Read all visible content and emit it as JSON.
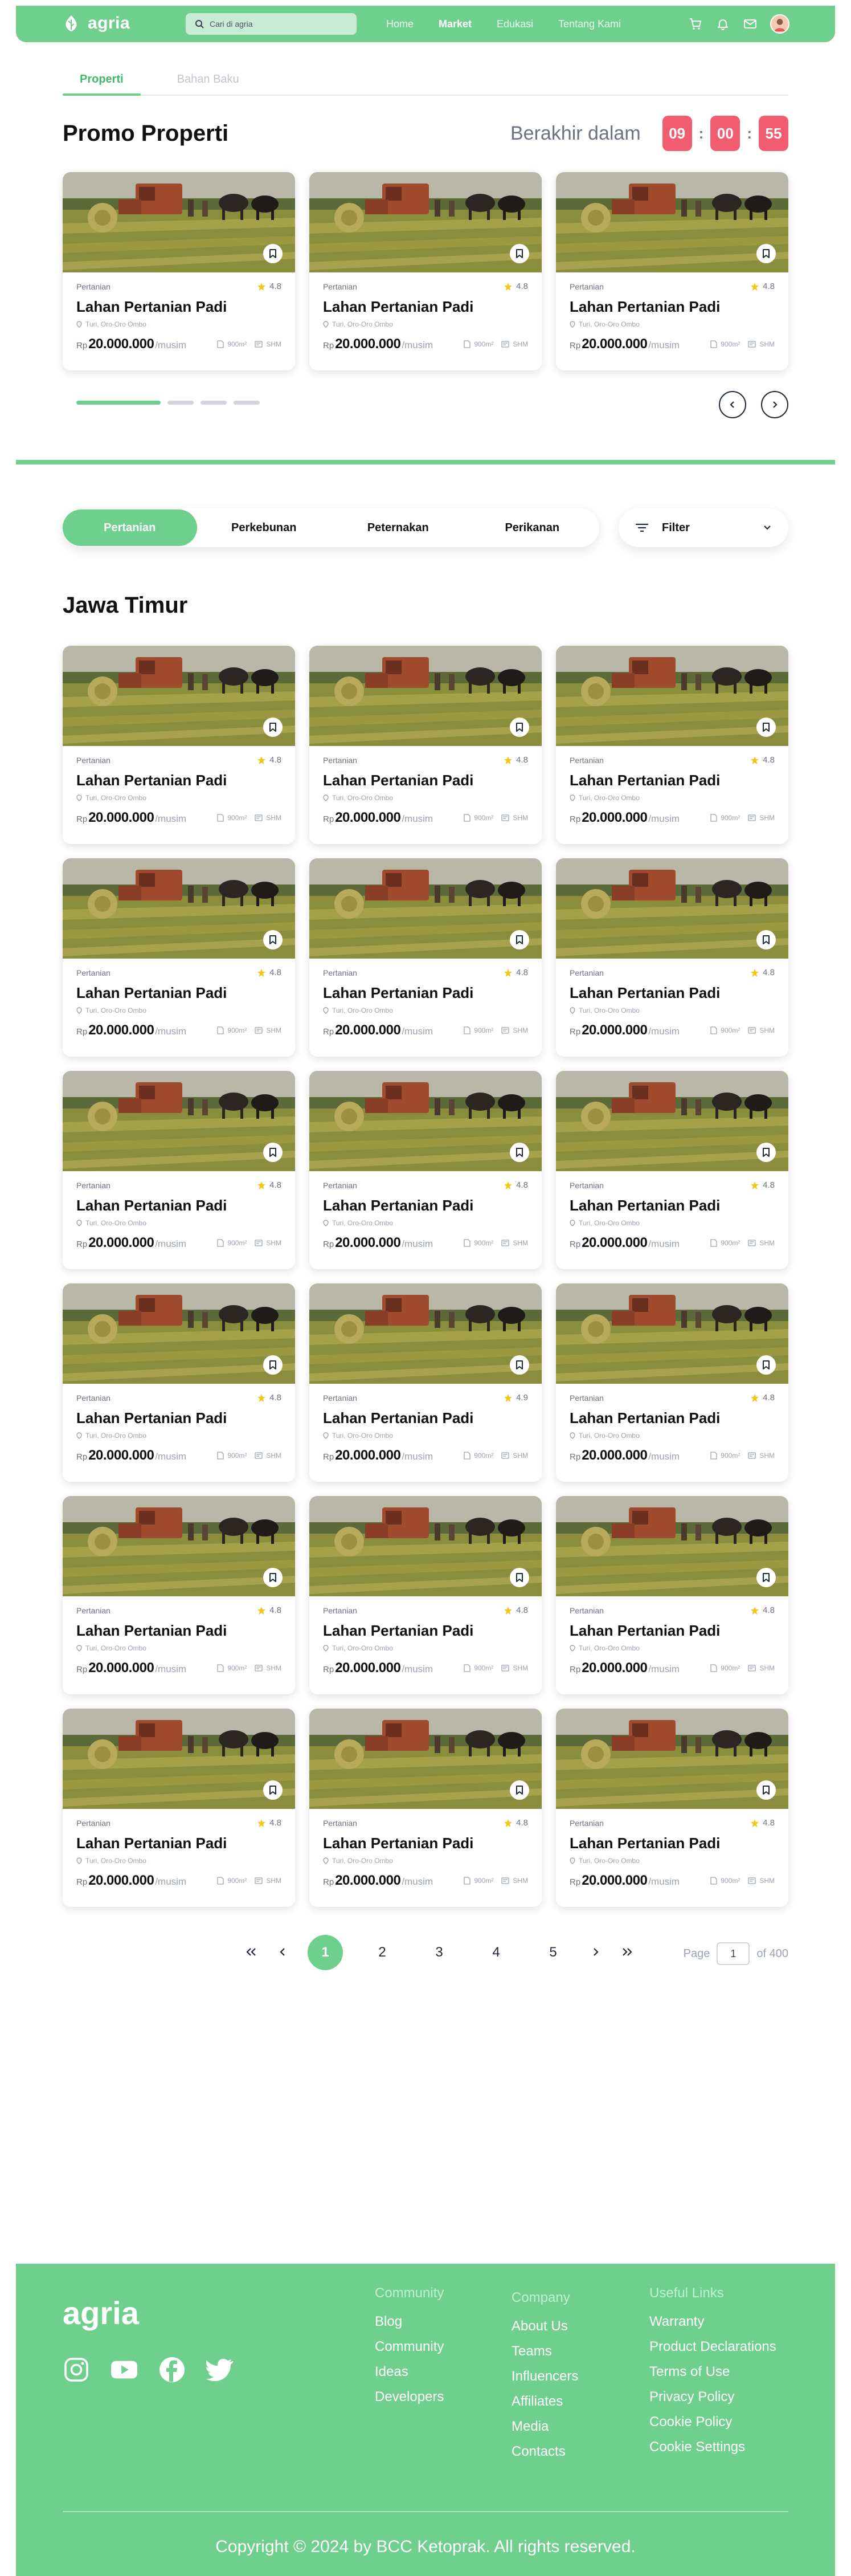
{
  "navbar": {
    "brand": "agria",
    "search_placeholder": "Cari di agria",
    "links": [
      {
        "label": "Home",
        "active": false
      },
      {
        "label": "Market",
        "active": true
      },
      {
        "label": "Edukasi",
        "active": false
      },
      {
        "label": "Tentang Kami",
        "active": false
      }
    ],
    "icons": [
      "cart-icon",
      "bell-icon",
      "mail-icon"
    ]
  },
  "top_tabs": [
    {
      "label": "Properti",
      "active": true
    },
    {
      "label": "Bahan Baku",
      "active": false
    }
  ],
  "promo": {
    "title": "Promo Properti",
    "countdown_label": "Berakhir dalam",
    "countdown": [
      "09",
      "00",
      "55"
    ],
    "cards": [
      {
        "category": "Pertanian",
        "rating": "4.8",
        "title": "Lahan Pertanian Padi",
        "location": "Turi, Oro-Oro Ombo",
        "currency": "Rp",
        "price": "20.000.000",
        "unit": "/musim",
        "area": "900m²",
        "cert": "SHM"
      },
      {
        "category": "Pertanian",
        "rating": "4.8",
        "title": "Lahan Pertanian Padi",
        "location": "Turi, Oro-Oro Ombo",
        "currency": "Rp",
        "price": "20.000.000",
        "unit": "/musim",
        "area": "900m²",
        "cert": "SHM"
      },
      {
        "category": "Pertanian",
        "rating": "4.8",
        "title": "Lahan Pertanian Padi",
        "location": "Turi, Oro-Oro Ombo",
        "currency": "Rp",
        "price": "20.000.000",
        "unit": "/musim",
        "area": "900m²",
        "cert": "SHM"
      }
    ]
  },
  "categories": [
    {
      "label": "Pertanian",
      "active": true
    },
    {
      "label": "Perkebunan",
      "active": false
    },
    {
      "label": "Peternakan",
      "active": false
    },
    {
      "label": "Perikanan",
      "active": false
    }
  ],
  "filter_label": "Filter",
  "region_title": "Jawa Timur",
  "listings": [
    {
      "category": "Pertanian",
      "rating": "4.8",
      "title": "Lahan Pertanian Padi",
      "location": "Turi, Oro-Oro Ombo",
      "currency": "Rp",
      "price": "20.000.000",
      "unit": "/musim",
      "area": "900m²",
      "cert": "SHM"
    },
    {
      "category": "Pertanian",
      "rating": "4.8",
      "title": "Lahan Pertanian Padi",
      "location": "Turi, Oro-Oro Ombo",
      "currency": "Rp",
      "price": "20.000.000",
      "unit": "/musim",
      "area": "900m²",
      "cert": "SHM"
    },
    {
      "category": "Pertanian",
      "rating": "4.8",
      "title": "Lahan Pertanian Padi",
      "location": "Turi, Oro-Oro Ombo",
      "currency": "Rp",
      "price": "20.000.000",
      "unit": "/musim",
      "area": "900m²",
      "cert": "SHM"
    },
    {
      "category": "Pertanian",
      "rating": "4.8",
      "title": "Lahan Pertanian Padi",
      "location": "Turi, Oro-Oro Ombo",
      "currency": "Rp",
      "price": "20.000.000",
      "unit": "/musim",
      "area": "900m²",
      "cert": "SHM"
    },
    {
      "category": "Pertanian",
      "rating": "4.8",
      "title": "Lahan Pertanian Padi",
      "location": "Turi, Oro-Oro Ombo",
      "currency": "Rp",
      "price": "20.000.000",
      "unit": "/musim",
      "area": "900m²",
      "cert": "SHM"
    },
    {
      "category": "Pertanian",
      "rating": "4.8",
      "title": "Lahan Pertanian Padi",
      "location": "Turi, Oro-Oro Ombo",
      "currency": "Rp",
      "price": "20.000.000",
      "unit": "/musim",
      "area": "900m²",
      "cert": "SHM"
    },
    {
      "category": "Pertanian",
      "rating": "4.8",
      "title": "Lahan Pertanian Padi",
      "location": "Turi, Oro-Oro Ombo",
      "currency": "Rp",
      "price": "20.000.000",
      "unit": "/musim",
      "area": "900m²",
      "cert": "SHM"
    },
    {
      "category": "Pertanian",
      "rating": "4.8",
      "title": "Lahan Pertanian Padi",
      "location": "Turi, Oro-Oro Ombo",
      "currency": "Rp",
      "price": "20.000.000",
      "unit": "/musim",
      "area": "900m²",
      "cert": "SHM"
    },
    {
      "category": "Pertanian",
      "rating": "4.8",
      "title": "Lahan Pertanian Padi",
      "location": "Turi, Oro-Oro Ombo",
      "currency": "Rp",
      "price": "20.000.000",
      "unit": "/musim",
      "area": "900m²",
      "cert": "SHM"
    },
    {
      "category": "Pertanian",
      "rating": "4.8",
      "title": "Lahan Pertanian Padi",
      "location": "Turi, Oro-Oro Ombo",
      "currency": "Rp",
      "price": "20.000.000",
      "unit": "/musim",
      "area": "900m²",
      "cert": "SHM"
    },
    {
      "category": "Pertanian",
      "rating": "4.9",
      "title": "Lahan Pertanian Padi",
      "location": "Turi, Oro-Oro Ombo",
      "currency": "Rp",
      "price": "20.000.000",
      "unit": "/musim",
      "area": "900m²",
      "cert": "SHM"
    },
    {
      "category": "Pertanian",
      "rating": "4.8",
      "title": "Lahan Pertanian Padi",
      "location": "Turi, Oro-Oro Ombo",
      "currency": "Rp",
      "price": "20.000.000",
      "unit": "/musim",
      "area": "900m²",
      "cert": "SHM"
    },
    {
      "category": "Pertanian",
      "rating": "4.8",
      "title": "Lahan Pertanian Padi",
      "location": "Turi, Oro-Oro Ombo",
      "currency": "Rp",
      "price": "20.000.000",
      "unit": "/musim",
      "area": "900m²",
      "cert": "SHM"
    },
    {
      "category": "Pertanian",
      "rating": "4.8",
      "title": "Lahan Pertanian Padi",
      "location": "Turi, Oro-Oro Ombo",
      "currency": "Rp",
      "price": "20.000.000",
      "unit": "/musim",
      "area": "900m²",
      "cert": "SHM"
    },
    {
      "category": "Pertanian",
      "rating": "4.8",
      "title": "Lahan Pertanian Padi",
      "location": "Turi, Oro-Oro Ombo",
      "currency": "Rp",
      "price": "20.000.000",
      "unit": "/musim",
      "area": "900m²",
      "cert": "SHM"
    },
    {
      "category": "Pertanian",
      "rating": "4.8",
      "title": "Lahan Pertanian Padi",
      "location": "Turi, Oro-Oro Ombo",
      "currency": "Rp",
      "price": "20.000.000",
      "unit": "/musim",
      "area": "900m²",
      "cert": "SHM"
    },
    {
      "category": "Pertanian",
      "rating": "4.8",
      "title": "Lahan Pertanian Padi",
      "location": "Turi, Oro-Oro Ombo",
      "currency": "Rp",
      "price": "20.000.000",
      "unit": "/musim",
      "area": "900m²",
      "cert": "SHM"
    },
    {
      "category": "Pertanian",
      "rating": "4.8",
      "title": "Lahan Pertanian Padi",
      "location": "Turi, Oro-Oro Ombo",
      "currency": "Rp",
      "price": "20.000.000",
      "unit": "/musim",
      "area": "900m²",
      "cert": "SHM"
    }
  ],
  "pagination": {
    "pages": [
      "1",
      "2",
      "3",
      "4",
      "5"
    ],
    "active": "1",
    "page_label": "Page",
    "current": "1",
    "of_label": "of 400"
  },
  "footer": {
    "brand": "agria",
    "social": [
      "instagram-icon",
      "youtube-icon",
      "facebook-icon",
      "twitter-icon"
    ],
    "columns": [
      {
        "title": "Community",
        "links": [
          "Blog",
          "Community",
          "Ideas",
          "Developers"
        ]
      },
      {
        "title": "Company",
        "links": [
          "About Us",
          "Teams",
          "Influencers",
          "Affiliates",
          "Media",
          "Contacts"
        ]
      },
      {
        "title": "Useful Links",
        "links": [
          "Warranty",
          "Product Declarations",
          "Terms of Use",
          "Privacy Policy",
          "Cookie Policy",
          "Cookie Settings"
        ]
      }
    ],
    "copyright": "Copyright © 2024 by BCC Ketoprak. All rights reserved."
  },
  "colors": {
    "primary": "#6fcf8d",
    "countdown": "#f25c6f",
    "star": "#f5c518"
  }
}
